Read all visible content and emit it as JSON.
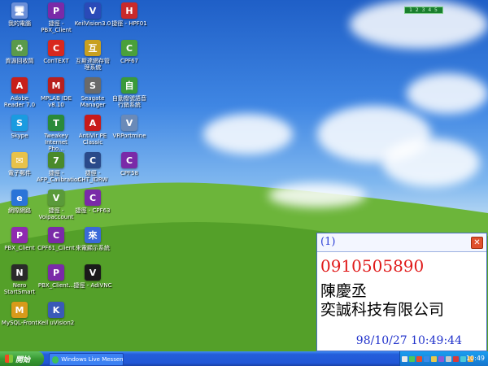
{
  "desktop": {
    "icons": [
      {
        "label": "我的電腦",
        "color": "#6b8fd8",
        "glyph": "🖥"
      },
      {
        "label": "資源回收筒",
        "color": "#5a9a4a",
        "glyph": "♻"
      },
      {
        "label": "Adobe Reader 7.0",
        "color": "#c8201a",
        "glyph": "A"
      },
      {
        "label": "Skype",
        "color": "#1a9be0",
        "glyph": "S"
      },
      {
        "label": "電子郵件",
        "color": "#e8c24a",
        "glyph": "✉"
      },
      {
        "label": "網際網路",
        "color": "#2a74d8",
        "glyph": "e"
      },
      {
        "label": "PBX_Client",
        "color": "#8f2bb0",
        "glyph": "P"
      },
      {
        "label": "Nero StartSmart",
        "color": "#2a2a2a",
        "glyph": "N"
      },
      {
        "label": "MySQL-Front",
        "color": "#d89a1a",
        "glyph": "M"
      },
      {
        "label": "捷徑 - PBX_Client",
        "color": "#7a2aa8",
        "glyph": "P"
      },
      {
        "label": "ConTEXT",
        "color": "#d8281e",
        "glyph": "C"
      },
      {
        "label": "MPLAB IDE v8.10",
        "color": "#b8201e",
        "glyph": "M"
      },
      {
        "label": "Tweakey Internet Pho...",
        "color": "#2a8a3a",
        "glyph": "T"
      },
      {
        "label": "捷徑 - AFP_Calibration",
        "color": "#4a8a2a",
        "glyph": "7"
      },
      {
        "label": "捷徑 - Voipaccount",
        "color": "#5a9a3a",
        "glyph": "V"
      },
      {
        "label": "CPF61_Client",
        "color": "#7a2aa8",
        "glyph": "C"
      },
      {
        "label": "PBX_Client...",
        "color": "#7a2aa8",
        "glyph": "P"
      },
      {
        "label": "Keil uVision2",
        "color": "#3a5ab8",
        "glyph": "K"
      },
      {
        "label": "KeilVision3.0",
        "color": "#2a4ab8",
        "glyph": "V"
      },
      {
        "label": "互斯達網存管理系統",
        "color": "#c8a020",
        "glyph": "互"
      },
      {
        "label": "Seagate Manager",
        "color": "#6a6a6a",
        "glyph": "S"
      },
      {
        "label": "AntiVir PE Classic",
        "color": "#c81a1a",
        "glyph": "A"
      },
      {
        "label": "捷徑 - CHT_IDRW",
        "color": "#2a4a8a",
        "glyph": "C"
      },
      {
        "label": "捷徑 - CPF63",
        "color": "#7a2aa8",
        "glyph": "C"
      },
      {
        "label": "來電顯示系統",
        "color": "#3a6ad8",
        "glyph": "來"
      },
      {
        "label": "捷徑 - AdiVNC",
        "color": "#1a1a1a",
        "glyph": "V"
      },
      {
        "label": "捷徑 - HPF01",
        "color": "#c82a2a",
        "glyph": "H"
      },
      {
        "label": "CPF67",
        "color": "#4aa03a",
        "glyph": "C"
      },
      {
        "label": "自動撥號語音行銷系統",
        "color": "#3a9a3a",
        "glyph": "自"
      },
      {
        "label": "VRPortmine",
        "color": "#6a8ab8",
        "glyph": "V"
      },
      {
        "label": "CPF58",
        "color": "#7a2aa8",
        "glyph": "C"
      }
    ],
    "tray_top_text": "1 2 3 4 5"
  },
  "popup": {
    "index": "(1)",
    "close_symbol": "✕",
    "phone": "0910505890",
    "name": "陳慶丞",
    "company": "奕誠科技有限公司",
    "datetime": "98/10/27 10:49:44"
  },
  "taskbar": {
    "start_label": "開始",
    "task_label": "Windows Live Messen...",
    "clock": "10:49",
    "tray_colors": [
      "#e8e8e8",
      "#4ac85a",
      "#e84a2a",
      "#3a8ae8",
      "#e8c84a",
      "#8a5ad8",
      "#c8c8c8",
      "#d83a3a",
      "#4ac8d8",
      "#e8a83a"
    ]
  }
}
